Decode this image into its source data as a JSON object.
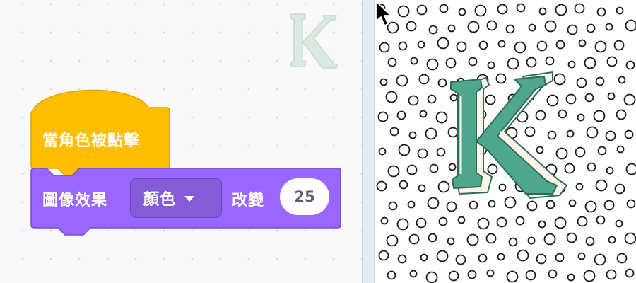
{
  "workspace": {
    "hat_block": {
      "label": "當角色被點擊",
      "color": "#ffbf00"
    },
    "effect_block": {
      "label": "圖像效果",
      "dropdown_value": "顏色",
      "change_label": "改變",
      "amount": "25",
      "color": "#9966ff"
    },
    "thumbnail": {
      "icon": "letter-k-sprite-icon",
      "letter": "K"
    }
  },
  "stage": {
    "backdrop": "polka-dot-icon",
    "sprite": {
      "icon": "letter-k-sprite-icon",
      "letter": "K",
      "color": "#4fa88d"
    },
    "cursor": "mouse-pointer-icon"
  }
}
